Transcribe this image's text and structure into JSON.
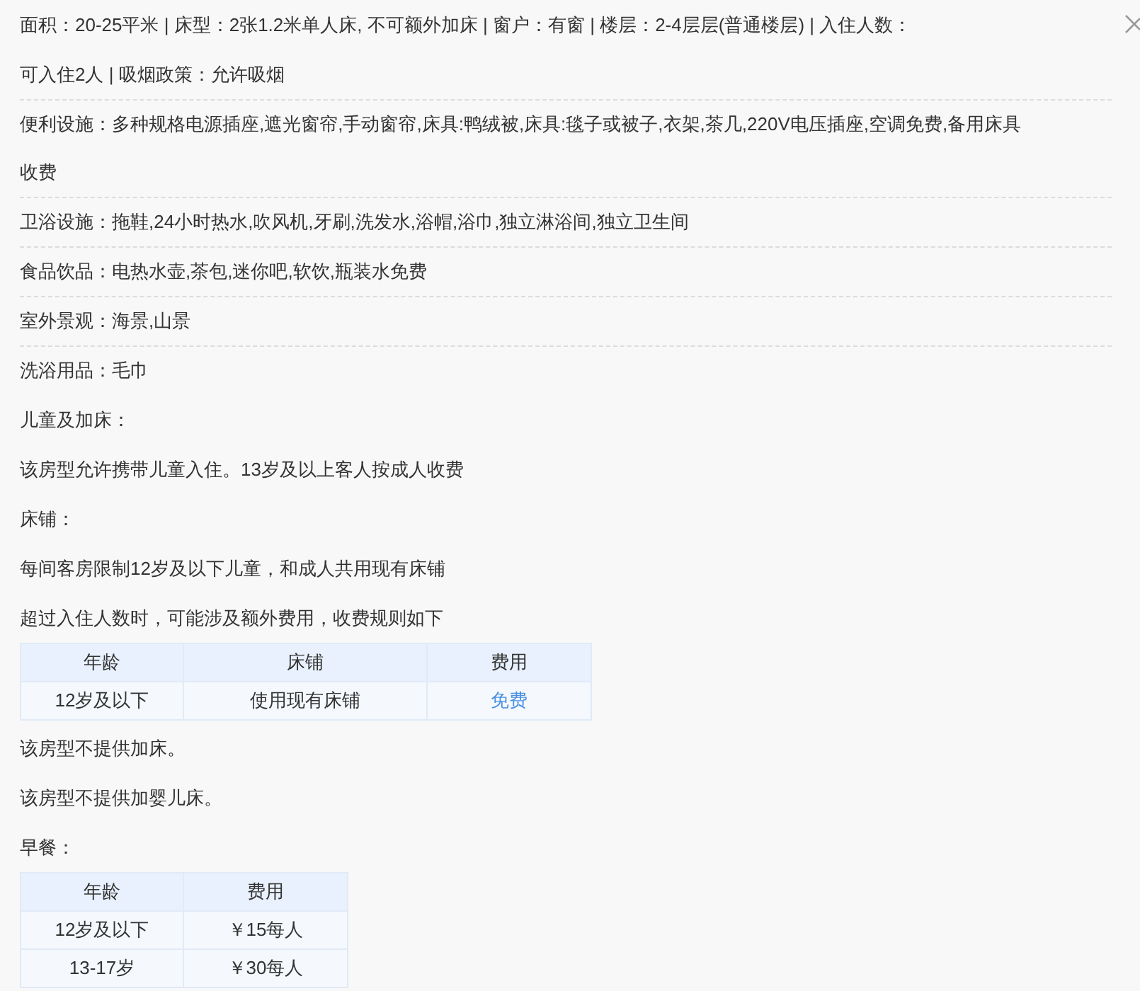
{
  "blocks": [
    {
      "kind": "summary",
      "text": "面积：20-25平米 | 床型：2张1.2米单人床, 不可额外加床 | 窗户：有窗 | 楼层：2-4层层(普通楼层) | 入住人数：可入住2人 | 吸烟政策：允许吸烟"
    },
    {
      "kind": "facility",
      "text": "便利设施：多种规格电源插座,遮光窗帘,手动窗帘,床具:鸭绒被,床具:毯子或被子,衣架,茶几,220V电压插座,空调免费,备用床具收费"
    },
    {
      "kind": "facility",
      "text": "卫浴设施：拖鞋,24小时热水,吹风机,牙刷,洗发水,浴帽,浴巾,独立淋浴间,独立卫生间"
    },
    {
      "kind": "facility",
      "text": "食品饮品：电热水壶,茶包,迷你吧,软饮,瓶装水免费"
    },
    {
      "kind": "facility",
      "text": "室外景观：海景,山景"
    },
    {
      "kind": "facility",
      "text": "洗浴用品：毛巾"
    },
    {
      "kind": "text",
      "text": "儿童及加床："
    },
    {
      "kind": "text",
      "text": "该房型允许携带儿童入住。13岁及以上客人按成人收费"
    },
    {
      "kind": "text",
      "text": "床铺："
    },
    {
      "kind": "text",
      "text": "每间客房限制12岁及以下儿童，和成人共用现有床铺"
    },
    {
      "kind": "text",
      "text": "超过入住人数时，可能涉及额外费用，收费规则如下"
    },
    {
      "kind": "table",
      "columns": [
        "年龄",
        "床铺",
        "费用"
      ],
      "rows": [
        [
          {
            "text": "12岁及以下",
            "highlighted": false
          },
          {
            "text": "使用现有床铺",
            "highlighted": false
          },
          {
            "text": "免费",
            "highlighted": true
          }
        ]
      ]
    },
    {
      "kind": "text",
      "text": "该房型不提供加床。"
    },
    {
      "kind": "text",
      "text": "该房型不提供加婴儿床。"
    },
    {
      "kind": "text",
      "text": "早餐："
    },
    {
      "kind": "table",
      "columns": [
        "年龄",
        "费用"
      ],
      "rows": [
        [
          {
            "text": "12岁及以下",
            "highlighted": false
          },
          {
            "text": "￥15每人",
            "highlighted": false
          }
        ],
        [
          {
            "text": "13-17岁",
            "highlighted": false
          },
          {
            "text": "￥30每人",
            "highlighted": false
          }
        ]
      ]
    }
  ]
}
